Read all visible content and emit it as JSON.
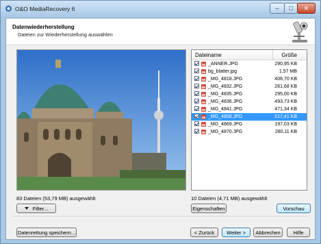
{
  "window": {
    "title": "O&O MediaRecovery 6",
    "minimize": "–",
    "maximize": "□",
    "close": "✕"
  },
  "header": {
    "title": "Datenwiederherstellung",
    "subtitle": "Dateien zur Wiederherstellung auswählen"
  },
  "filelist": {
    "col_name": "Dateiname",
    "col_size": "Größe",
    "rows": [
      {
        "name": "_ANNER.JPG",
        "size": "290,95 KB",
        "selected": false
      },
      {
        "name": "bg_blatter.jpg",
        "size": "1,57 MB",
        "selected": false
      },
      {
        "name": "_MG_4818.JPG",
        "size": "406,70 KB",
        "selected": false
      },
      {
        "name": "_MG_4832.JPG",
        "size": "261,68 KB",
        "selected": false
      },
      {
        "name": "_MG_4835.JPG",
        "size": "295,00 KB",
        "selected": false
      },
      {
        "name": "_MG_4836.JPG",
        "size": "493,73 KB",
        "selected": false
      },
      {
        "name": "_MG_4841.JPG",
        "size": "471,34 KB",
        "selected": false
      },
      {
        "name": "_MG_4858.JPG",
        "size": "517,41 KB",
        "selected": true
      },
      {
        "name": "_MG_4869.JPG",
        "size": "197,03 KB",
        "selected": false
      },
      {
        "name": "_MG_4870.JPG",
        "size": "280,11 KB",
        "selected": false
      }
    ]
  },
  "status": {
    "left": "83 Dateien (53,79 MB) ausgewählt",
    "right": "10 Dateien (4,71 MB) ausgewählt"
  },
  "buttons": {
    "filter": "Filter...",
    "properties": "Eigenschaften",
    "preview": "Vorschau",
    "save_recovery": "Datenrettung speichern...",
    "back": "< Zurück",
    "next": "Weiter >",
    "cancel": "Abbrechen",
    "help": "Hilfe"
  }
}
